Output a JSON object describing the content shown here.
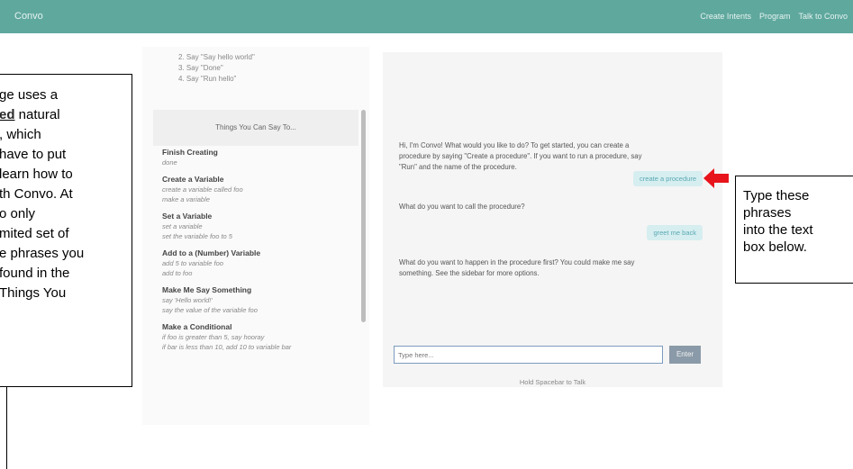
{
  "navbar": {
    "brand": "Convo",
    "links": [
      "Create Intents",
      "Program",
      "Talk to Convo"
    ]
  },
  "sidebar": {
    "steps": [
      "2. Say \"Say hello world\"",
      "3. Say \"Done\"",
      "4. Say \"Run hello\""
    ],
    "things_header": "Things You Can Say To...",
    "commands": [
      {
        "title": "Finish Creating",
        "examples": [
          "done"
        ]
      },
      {
        "title": "Create a Variable",
        "examples": [
          "create a variable called foo",
          "make a variable"
        ]
      },
      {
        "title": "Set a Variable",
        "examples": [
          "set a variable",
          "set the variable foo to 5"
        ]
      },
      {
        "title": "Add to a (Number) Variable",
        "examples": [
          "add 5 to variable foo",
          "add to foo"
        ]
      },
      {
        "title": "Make Me Say Something",
        "examples": [
          "say 'Hello world!'",
          "say the value of the variable foo"
        ]
      },
      {
        "title": "Make a Conditional",
        "examples": [
          "if foo is greater than 5, say hooray",
          "if bar is less than 10, add 10 to variable bar"
        ]
      }
    ]
  },
  "chat": {
    "bot1": [
      "Hi, I'm Convo! What would you like to do? To get started, you can create a",
      "procedure by saying \"Create a procedure\". If you want to run a procedure, say",
      "\"Run\" and the name of the procedure."
    ],
    "user1": "create a procedure",
    "bot2": "What do you want to call the procedure?",
    "user2": "greet me back",
    "bot3": [
      "What do you want to happen in the procedure first? You could make me say",
      "something. See the sidebar for more options."
    ],
    "input_placeholder": "Type here...",
    "enter_label": "Enter",
    "hold_label": "Hold Spacebar to Talk"
  },
  "overlay_left": {
    "lines": [
      {
        "text": "ge uses a",
        "emph": false
      },
      {
        "text": "ed",
        "emph": true,
        "rest": " natural"
      },
      {
        "text": ", which",
        "emph": false
      },
      {
        "text": "have to put",
        "emph": false
      },
      {
        "text": " learn how to",
        "emph": false
      },
      {
        "text": "th Convo. At",
        "emph": false
      },
      {
        "text": "o only",
        "emph": false
      },
      {
        "text": "mited set of",
        "emph": false
      },
      {
        "text": "e phrases you",
        "emph": false
      },
      {
        "text": "found in the",
        "emph": false
      },
      {
        "text": "Things You",
        "emph": false
      }
    ]
  },
  "overlay_right": {
    "lines": [
      "Type these",
      "phrases",
      "into the text",
      "box below."
    ]
  },
  "colors": {
    "navbar": "#5fa89e",
    "arrow": "#e8141c",
    "bubble_bg": "#d6eef0",
    "bubble_text": "#5aa9b3"
  },
  "icons": {
    "arrow": "red-left-arrow-icon"
  }
}
